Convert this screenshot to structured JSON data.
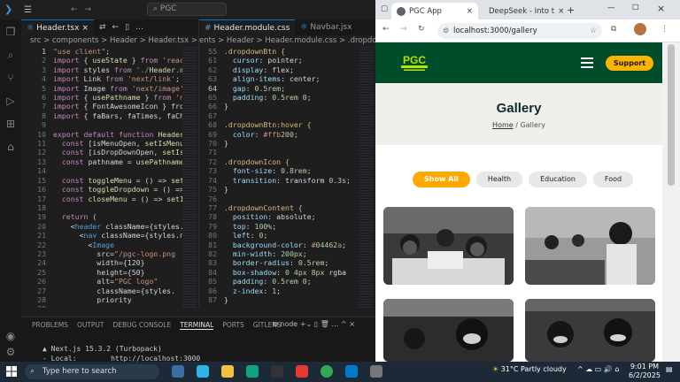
{
  "vscode": {
    "search": "PGC",
    "tabs": [
      {
        "label": "Header.tsx",
        "active": true
      },
      {
        "label": "Header.module.css",
        "active": false
      },
      {
        "label": "Navbar.jsx",
        "active": false
      }
    ],
    "breadcrumb_left": "src > components > Header > Header.tsx > ...",
    "breadcrumb_right": "ents > Header > Header.module.css > .dropdownBtn",
    "left_lines": [
      {
        "n": "1",
        "t": "\"use client\";"
      },
      {
        "n": "2",
        "t": "import { useState } from 'reac"
      },
      {
        "n": "3",
        "t": "import styles from './Header.m"
      },
      {
        "n": "4",
        "t": "import Link from 'next/link';"
      },
      {
        "n": "5",
        "t": "import Image from 'next/image'"
      },
      {
        "n": "6",
        "t": "import { usePathname } from 'n"
      },
      {
        "n": "7",
        "t": "import { FontAwesomeIcon } fro"
      },
      {
        "n": "8",
        "t": "import { faBars, faTimes, faCh"
      },
      {
        "n": "9",
        "t": ""
      },
      {
        "n": "10",
        "t": "export default function Header"
      },
      {
        "n": "11",
        "t": "  const [isMenuOpen, setIsMenu"
      },
      {
        "n": "12",
        "t": "  const [isDropDownOpen, setIs"
      },
      {
        "n": "13",
        "t": "  const pathname = usePathname"
      },
      {
        "n": "14",
        "t": ""
      },
      {
        "n": "15",
        "t": "  const toggleMenu = () => set"
      },
      {
        "n": "16",
        "t": "  const toggleDropdown = () =>"
      },
      {
        "n": "17",
        "t": "  const closeMenu = () => setI"
      },
      {
        "n": "18",
        "t": ""
      },
      {
        "n": "19",
        "t": "  return ("
      },
      {
        "n": "20",
        "t": "    <header className={styles.h"
      },
      {
        "n": "21",
        "t": "      <nav className={styles.n"
      },
      {
        "n": "22",
        "t": "        <Image"
      },
      {
        "n": "23",
        "t": "          src=\"/pgc-logo.png"
      },
      {
        "n": "24",
        "t": "          width={120}"
      },
      {
        "n": "25",
        "t": "          height={50}"
      },
      {
        "n": "26",
        "t": "          alt=\"PGC logo\""
      },
      {
        "n": "27",
        "t": "          className={styles."
      },
      {
        "n": "28",
        "t": "          priority"
      },
      {
        "n": "29",
        "t": ""
      }
    ],
    "right_lines": [
      {
        "n": "55",
        "t": ".dropdownBtn {"
      },
      {
        "n": "61",
        "t": "  cursor: pointer;"
      },
      {
        "n": "62",
        "t": "  display: flex;"
      },
      {
        "n": "63",
        "t": "  align-items: center;"
      },
      {
        "n": "64",
        "t": "  gap: 0.5rem;"
      },
      {
        "n": "65",
        "t": "  padding: 0.5rem 0;"
      },
      {
        "n": "66",
        "t": "}"
      },
      {
        "n": "67",
        "t": ""
      },
      {
        "n": "68",
        "t": ".dropdownBtn:hover {"
      },
      {
        "n": "69",
        "t": "  color: #ffb200;"
      },
      {
        "n": "70",
        "t": "}"
      },
      {
        "n": "71",
        "t": ""
      },
      {
        "n": "72",
        "t": ".dropdownIcon {"
      },
      {
        "n": "73",
        "t": "  font-size: 0.8rem;"
      },
      {
        "n": "74",
        "t": "  transition: transform 0.3s;"
      },
      {
        "n": "75",
        "t": "}"
      },
      {
        "n": "76",
        "t": ""
      },
      {
        "n": "77",
        "t": ".dropdownContent {"
      },
      {
        "n": "78",
        "t": "  position: absolute;"
      },
      {
        "n": "79",
        "t": "  top: 100%;"
      },
      {
        "n": "80",
        "t": "  left: 0;"
      },
      {
        "n": "81",
        "t": "  background-color: #04462a;"
      },
      {
        "n": "82",
        "t": "  min-width: 200px;"
      },
      {
        "n": "83",
        "t": "  border-radius: 0.5rem;"
      },
      {
        "n": "84",
        "t": "  box-shadow: 0 4px 8px rgba"
      },
      {
        "n": "85",
        "t": "  padding: 0.5rem 0;"
      },
      {
        "n": "86",
        "t": "  z-index: 1;"
      },
      {
        "n": "87",
        "t": "}"
      }
    ],
    "panel_tabs": [
      "PROBLEMS",
      "OUTPUT",
      "DEBUG CONSOLE",
      "TERMINAL",
      "PORTS",
      "GITLENS"
    ],
    "panel_active": "TERMINAL",
    "terminal_shell": "node",
    "terminal_lines": [
      "▲ Next.js 15.3.2 (Turbopack)",
      "- Local:        http://localhost:3000"
    ]
  },
  "chrome": {
    "tabs": [
      {
        "label": "PGC App",
        "active": true
      },
      {
        "label": "DeepSeek - Into t",
        "active": false
      }
    ],
    "url": "localhost:3000/gallery"
  },
  "site": {
    "logo_text": "PGC",
    "logo_sub": "PURPOSE AND GLORY CAMPAIGN",
    "support_label": "Support",
    "page_title": "Gallery",
    "breadcrumb_home": "Home",
    "breadcrumb_current": "/ Gallery",
    "filters": [
      "Show All",
      "Health",
      "Education",
      "Food"
    ],
    "active_filter": "Show All",
    "header_color": "#004d2c",
    "accent_color": "#ffa900"
  },
  "taskbar": {
    "search_placeholder": "Type here to search",
    "weather": "31°C  Partly cloudy",
    "time": "9:01 PM",
    "date": "6/2/2025"
  }
}
